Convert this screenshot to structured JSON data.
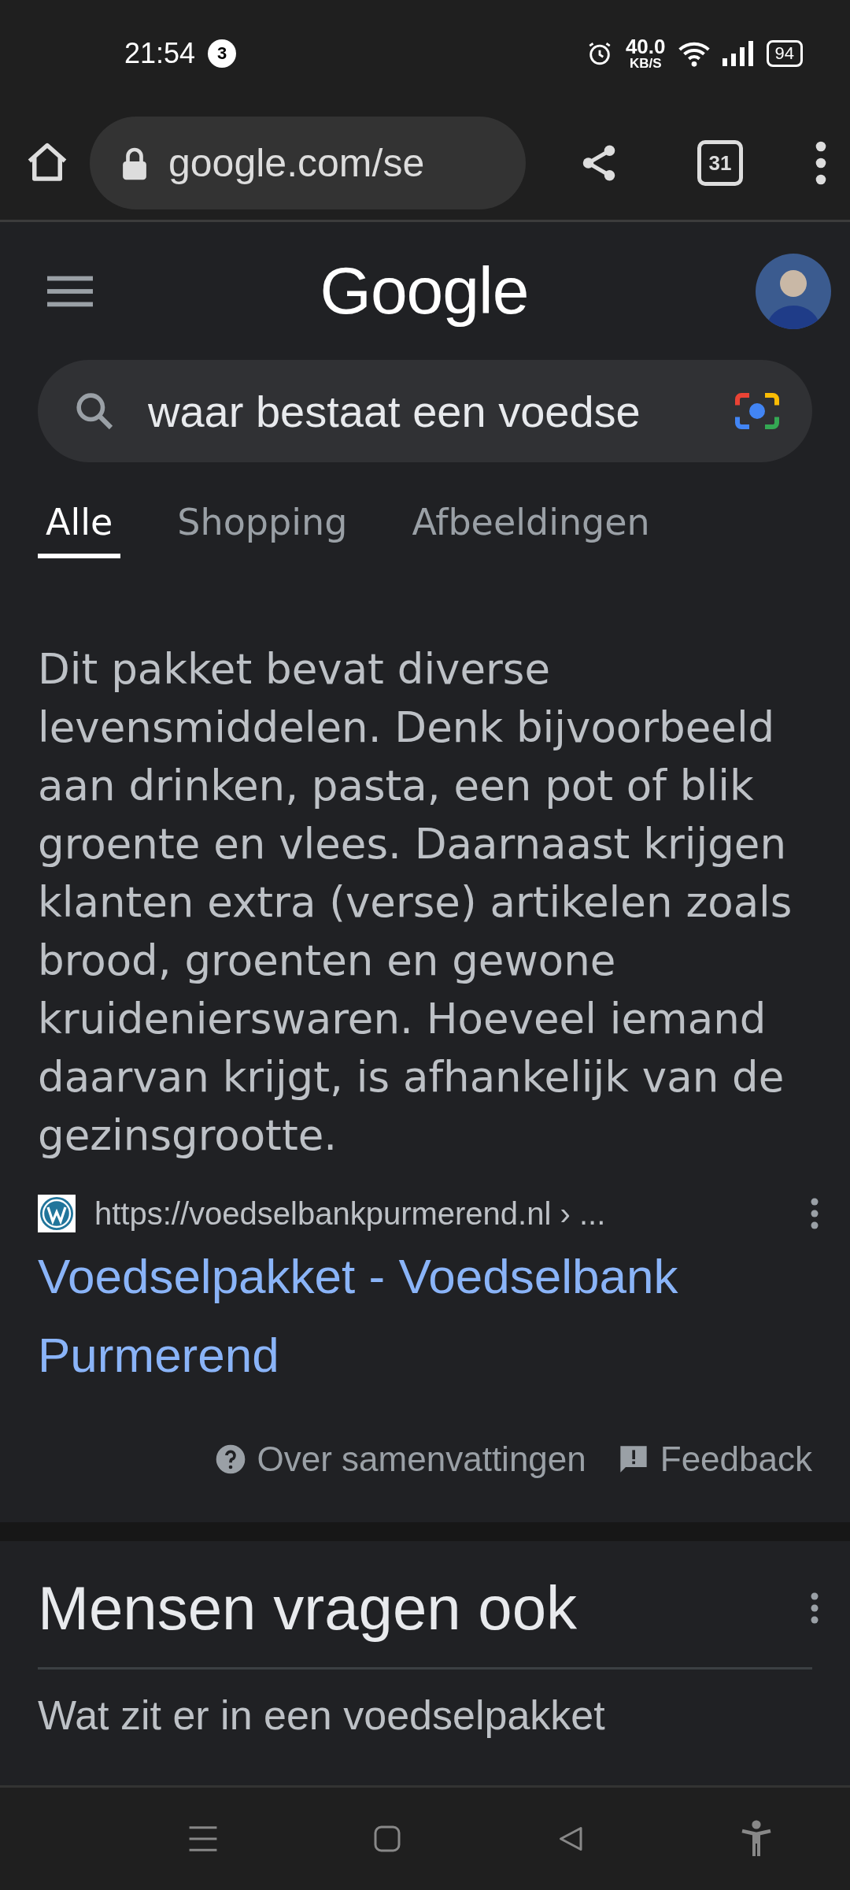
{
  "status_bar": {
    "time": "21:54",
    "notification_count": "3",
    "net_speed": "40.0",
    "net_unit": "KB/S",
    "battery": "94"
  },
  "browser_toolbar": {
    "url": "google.com/se",
    "tab_count": "31"
  },
  "header": {
    "logo": "Google"
  },
  "search": {
    "value": "waar bestaat een voedse"
  },
  "tabs": [
    {
      "label": "Alle",
      "selected": true
    },
    {
      "label": "Shopping",
      "selected": false
    },
    {
      "label": "Afbeeldingen",
      "selected": false
    }
  ],
  "snippet": {
    "text": "Dit pakket bevat diverse levensmiddelen. Denk bijvoorbeeld aan drinken, pasta, een pot of blik groente en vlees. Daarnaast krijgen klanten extra (verse) artikelen zoals brood, groenten en gewone kruidenierswaren. Hoeveel iemand daarvan krijgt, is afhankelijk van de gezinsgrootte.",
    "source_url": "https://voedselbankpurmerend.nl › ...",
    "result_title": "Voedselpakket - Voedselbank Purmerend",
    "about_link": "Over samenvattingen",
    "feedback_link": "Feedback"
  },
  "people_also_ask": {
    "heading": "Mensen vragen ook",
    "questions": [
      "Wat zit er in een voedselpakket"
    ]
  }
}
